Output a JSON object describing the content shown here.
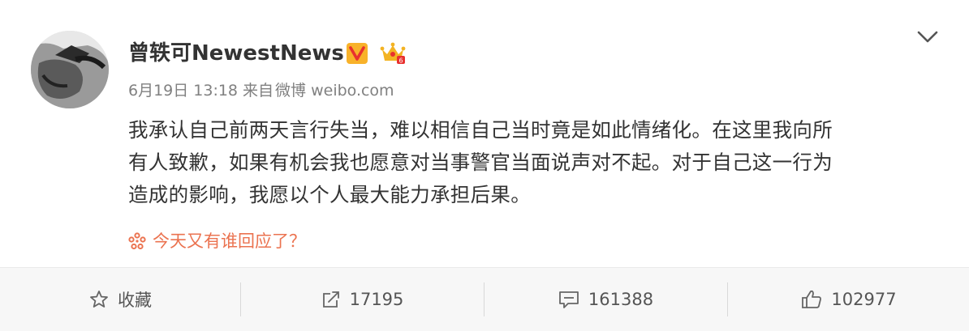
{
  "post": {
    "username": "曾轶可NewestNews",
    "date": "6月19日",
    "time": "13:18",
    "source_prefix": "来自",
    "source": "微博 weibo.com",
    "text_lines": [
      "我承认自己前两天言行失当，难以相信自己当时竟是如此情绪化。在这里我向所",
      "有人致歉，如果有机会我也愿意对当事警官当面说声对不起。对于自己这一行为",
      "造成的影响，我愿以个人最大能力承担后果。"
    ],
    "topic": "今天又有谁回应了？"
  },
  "badges": {
    "verified_icon": "v-verified-icon",
    "verified_color": "#f8b22a",
    "crown_icon": "crown-member-icon",
    "crown_color": "#f3b323"
  },
  "actions": {
    "favorite_label": "收藏",
    "repost_count": "17195",
    "comment_count": "161388",
    "like_count": "102977"
  },
  "colors": {
    "topic": "#eb7350",
    "text": "#333333",
    "meta": "#808080",
    "bar_bg": "#f7f7f7"
  }
}
